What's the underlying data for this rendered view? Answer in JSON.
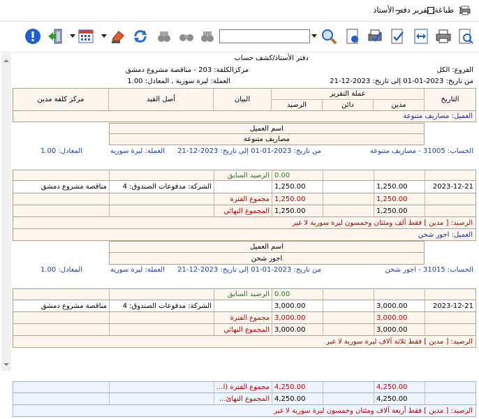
{
  "window": {
    "title": "طباعة: تقرير دفتر الأستاذ"
  },
  "toolbar": {
    "search_value": ""
  },
  "report_header": {
    "title": "دفتر الأستاذ/كشف حساب",
    "cost_center": "مركزالكلفة: 203 - مناقصة مشروع دمشق",
    "branches": "الفروع: الكل",
    "currency_line": "العملة: ليرة سورية , المعادل: 1.00",
    "date_range": "من تاريخ: 2023-01-01  إلى تاريخ: 2023-12-21"
  },
  "columns": {
    "date": "التاريخ",
    "report_currency": "عملة التقرير",
    "debit": "مدين",
    "credit": "دائن",
    "balance": "الرصيد",
    "statement": "البيان",
    "origin": "أصل القيد",
    "debit_cost_center": "مركز كلفة مدين"
  },
  "groups": [
    {
      "client": "العميل: مصاريف متنوعة",
      "client_name_label": "اسم العميل",
      "client_name": "مصاريف متنوعة",
      "account": "الحساب: 31005 - مصاريف متنوعة",
      "from_to": "من تاريخ: 2023-01-01   إلى تاريخ: 2023-12-21",
      "currency": "العملة: ليرة سورية",
      "equivalent": "المعادل: 1.00",
      "previous_balance_label": "الرصيد السابق",
      "previous_balance": "0.00",
      "entry": {
        "date": "2023-12-21",
        "debit": "1,250.00",
        "balance": "1,250.00",
        "statement": "الشركة: مدفوعات الصندوق: 4",
        "cost_center": "مناقصة مشروع دمشق"
      },
      "period_total_label": "مجموع الفترة",
      "period_debit": "1,250.00",
      "period_balance": "1,250.00",
      "final_total_label": "المجموع النهائي",
      "final_debit": "1,250.00",
      "final_balance": "1,250.00",
      "balance_words": "الرصيد: [ مدين ] فقط ألف ومئتان وخمسون ليرة سورية لا غير"
    },
    {
      "client": "العميل: اجور شحن",
      "client_name_label": "اسم العميل",
      "client_name": "اجور شحن",
      "account": "الحساب: 31015 - اجور شحن",
      "from_to": "من تاريخ: 2023-01-01   إلى تاريخ: 2023-12-21",
      "currency": "العملة: ليرة سورية",
      "equivalent": "المعادل: 1.00",
      "previous_balance_label": "الرصيد السابق",
      "previous_balance": "0.00",
      "entry": {
        "date": "2023-12-21",
        "debit": "3,000.00",
        "balance": "3,000.00",
        "statement": "الشركة: مدفوعات الصندوق: 4",
        "cost_center": "مناقصة مشروع دمشق"
      },
      "period_total_label": "مجموع الفترة",
      "period_debit": "3,000.00",
      "period_balance": "3,000.00",
      "final_total_label": "المجموع النهائي",
      "final_debit": "3,000.00",
      "final_balance": "3,000.00",
      "balance_words": "الرصيد: [ مدين ] فقط ثلاثة آلاف ليرة سورية لا غير"
    }
  ],
  "footer": {
    "period_total_label": "مجموع الفترة (ا...",
    "period_debit": "4,250.00",
    "period_balance": "4,250.00",
    "final_total_label": "المجموع النهائ...",
    "final_debit": "4,250.00",
    "final_balance": "4,250.00",
    "balance_words": "الرصيد: [ مدين ] فقط أربعة آلاف ومئتان وخمسون ليرة سورية لا غير"
  }
}
